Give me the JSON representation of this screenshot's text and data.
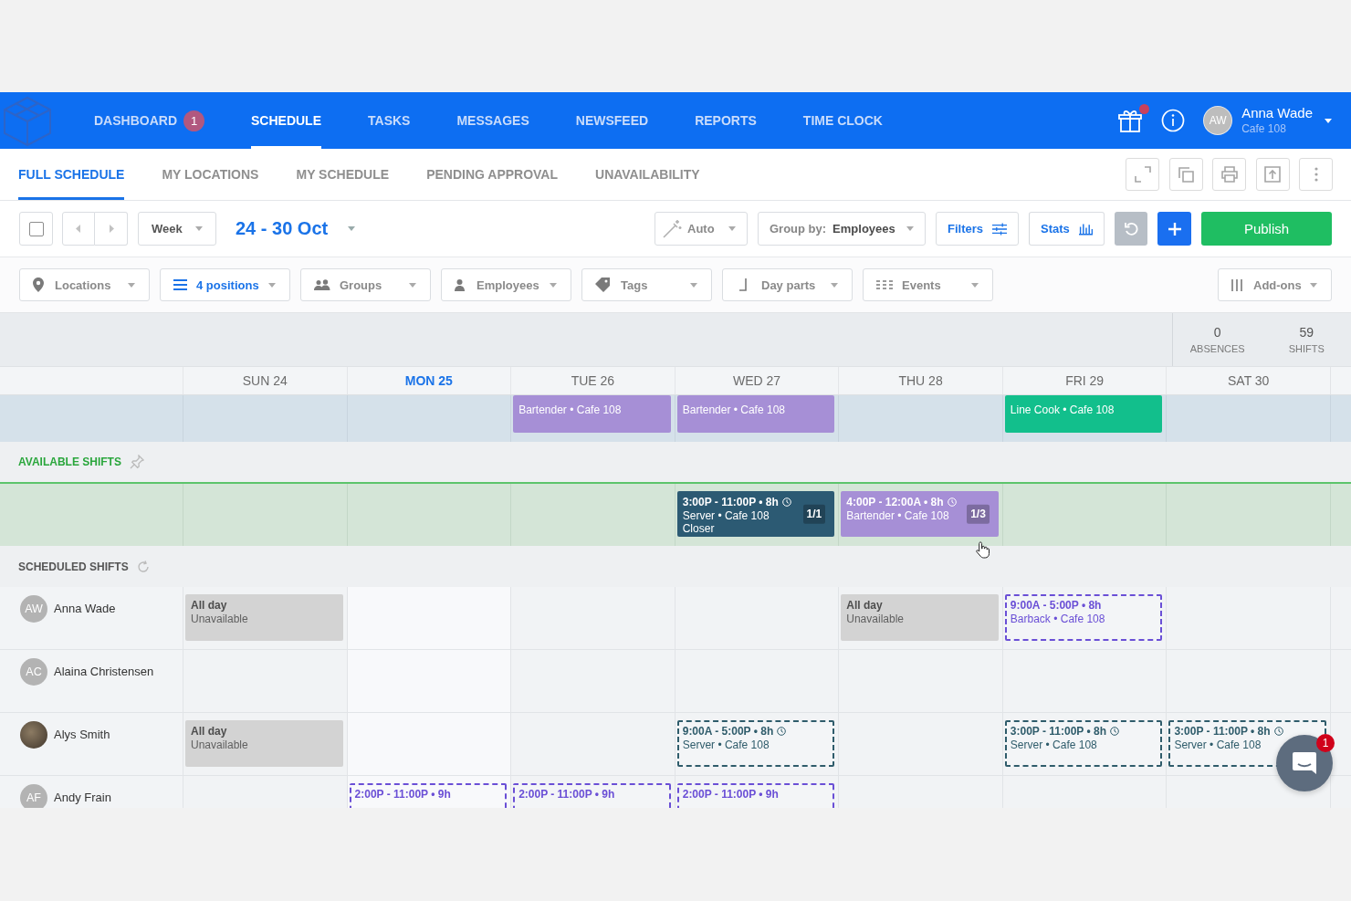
{
  "top_nav": {
    "items": [
      {
        "label": "DASHBOARD",
        "badge": "1",
        "selected": false
      },
      {
        "label": "SCHEDULE",
        "selected": true
      },
      {
        "label": "TASKS",
        "selected": false
      },
      {
        "label": "MESSAGES",
        "selected": false
      },
      {
        "label": "NEWSFEED",
        "selected": false
      },
      {
        "label": "REPORTS",
        "selected": false
      },
      {
        "label": "TIME CLOCK",
        "selected": false
      }
    ],
    "gift_notification": true,
    "user": {
      "initials": "AW",
      "name": "Anna Wade",
      "location": "Cafe 108"
    }
  },
  "sub_nav": {
    "tabs": [
      {
        "label": "FULL SCHEDULE",
        "selected": true
      },
      {
        "label": "MY LOCATIONS",
        "selected": false
      },
      {
        "label": "MY SCHEDULE",
        "selected": false
      },
      {
        "label": "PENDING APPROVAL",
        "selected": false
      },
      {
        "label": "UNAVAILABILITY",
        "selected": false
      }
    ]
  },
  "toolbar": {
    "select_all_checked": false,
    "view": "Week",
    "date_range": "24 - 30 Oct",
    "auto": "Auto",
    "group_by": {
      "label": "Group by:",
      "value": "Employees"
    },
    "filters_button": "Filters",
    "stats_button": "Stats",
    "publish_button": "Publish"
  },
  "filter_bar": {
    "filters": [
      {
        "label": "Locations",
        "active": false
      },
      {
        "label": "4 positions",
        "active": true
      },
      {
        "label": "Groups",
        "active": false
      },
      {
        "label": "Employees",
        "active": false
      },
      {
        "label": "Tags",
        "active": false
      },
      {
        "label": "Day parts",
        "active": false
      },
      {
        "label": "Events",
        "active": false
      }
    ],
    "addons": {
      "label": "Add-ons",
      "active": false
    }
  },
  "summary": [
    {
      "value": "0",
      "label": "ABSENCES"
    },
    {
      "value": "59",
      "label": "SHIFTS"
    }
  ],
  "days": [
    {
      "label": "SUN 24",
      "today": false
    },
    {
      "label": "MON 25",
      "today": true
    },
    {
      "label": "TUE 26",
      "today": false
    },
    {
      "label": "WED 27",
      "today": false
    },
    {
      "label": "THU 28",
      "today": false
    },
    {
      "label": "FRI 29",
      "today": false
    },
    {
      "label": "SAT 30",
      "today": false
    }
  ],
  "top_group": {
    "cells": [
      null,
      null,
      {
        "kind": "shift",
        "position": "Bartender • Cafe 108",
        "color": "#a68fd6"
      },
      {
        "kind": "shift",
        "position": "Bartender • Cafe 108",
        "color": "#a68fd6"
      },
      null,
      {
        "kind": "shift",
        "position": "Line Cook • Cafe 108",
        "color": "#12bf8c"
      },
      null
    ]
  },
  "available_shifts": {
    "title": "AVAILABLE SHIFTS",
    "cells": [
      null,
      null,
      null,
      {
        "kind": "shift",
        "time": "3:00P - 11:00P • 8h",
        "clock": true,
        "position": "Server • Cafe 108",
        "note": "Closer",
        "count": "1/1",
        "color": "#2c5a73"
      },
      {
        "kind": "shift",
        "time": "4:00P - 12:00A • 8h",
        "clock": true,
        "position": "Bartender • Cafe 108",
        "count": "1/3",
        "color": "#a68fd6"
      },
      null,
      null
    ]
  },
  "scheduled_shifts": {
    "title": "SCHEDULED SHIFTS",
    "employees": [
      {
        "name": "Anna Wade",
        "avatar": {
          "kind": "initials",
          "text": "AW"
        },
        "cells": [
          {
            "kind": "unavailable",
            "time": "All day",
            "reason": "Unavailable"
          },
          null,
          null,
          null,
          {
            "kind": "unavailable",
            "time": "All day",
            "reason": "Unavailable"
          },
          {
            "kind": "draft",
            "time": "9:00A - 5:00P • 8h",
            "clock": false,
            "position": "Barback • Cafe 108",
            "color": "#6a4fd6"
          },
          null
        ]
      },
      {
        "name": "Alaina Christensen",
        "avatar": {
          "kind": "initials",
          "text": "AC"
        },
        "cells": [
          null,
          null,
          null,
          null,
          null,
          null,
          null
        ]
      },
      {
        "name": "Alys Smith",
        "avatar": {
          "kind": "photo"
        },
        "cells": [
          {
            "kind": "unavailable",
            "time": "All day",
            "reason": "Unavailable"
          },
          null,
          null,
          {
            "kind": "draft",
            "time": "9:00A - 5:00P • 8h",
            "clock": true,
            "position": "Server • Cafe 108",
            "color": "#2f5c6b"
          },
          null,
          {
            "kind": "draft",
            "time": "3:00P - 11:00P • 8h",
            "clock": true,
            "position": "Server • Cafe 108",
            "color": "#2f5c6b"
          },
          {
            "kind": "draft",
            "time": "3:00P - 11:00P • 8h",
            "clock": true,
            "position": "Server • Cafe 108",
            "color": "#2f5c6b"
          }
        ]
      },
      {
        "name": "Andy Frain",
        "avatar": {
          "kind": "initials",
          "text": "AF"
        },
        "cells": [
          null,
          {
            "kind": "draft",
            "time": "2:00P - 11:00P • 9h",
            "clock": false,
            "color": "#6a4fd6"
          },
          {
            "kind": "draft",
            "time": "2:00P - 11:00P • 9h",
            "clock": false,
            "color": "#6a4fd6"
          },
          {
            "kind": "draft",
            "time": "2:00P - 11:00P • 9h",
            "clock": false,
            "color": "#6a4fd6"
          },
          null,
          null,
          null
        ]
      }
    ]
  },
  "chat": {
    "badge": "1"
  }
}
